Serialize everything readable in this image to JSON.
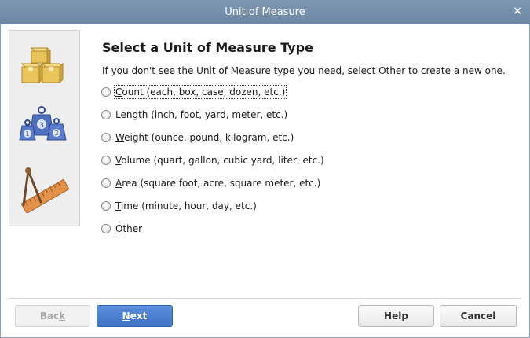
{
  "window": {
    "title": "Unit of Measure",
    "close_label": "×"
  },
  "main": {
    "heading": "Select a Unit of Measure Type",
    "instruction": "If you don't see the Unit of Measure type you need, select Other to create a new one.",
    "options": [
      {
        "accel": "C",
        "rest": "ount (each, box, case, dozen, etc.)",
        "selected": false
      },
      {
        "accel": "L",
        "rest": "ength (inch, foot, yard, meter, etc.)",
        "selected": false
      },
      {
        "accel": "W",
        "rest": "eight (ounce, pound, kilogram, etc.)",
        "selected": false
      },
      {
        "accel": "V",
        "rest": "olume (quart, gallon, cubic yard, liter, etc.)",
        "selected": false
      },
      {
        "accel": "A",
        "rest": "rea (square foot, acre, square meter, etc.)",
        "selected": false
      },
      {
        "accel": "T",
        "rest": "ime (minute, hour, day, etc.)",
        "selected": false
      },
      {
        "accel": "O",
        "rest": "ther",
        "selected": false
      }
    ]
  },
  "sidebar": {
    "icons": [
      "boxes-icon",
      "weights-icon",
      "ruler-compass-icon"
    ],
    "weight_numbers": [
      "1",
      "3",
      "2"
    ]
  },
  "footer": {
    "back": {
      "pre": "Bac",
      "accel": "k",
      "post": ""
    },
    "next": {
      "pre": "",
      "accel": "N",
      "post": "ext"
    },
    "help_label": "Help",
    "cancel_label": "Cancel"
  },
  "colors": {
    "titlebar": "#7290ae",
    "primary_button": "#4a7fd0",
    "box_gold": "#e8c45a",
    "weight_blue": "#4f6fbf",
    "ruler_orange": "#e3924a"
  }
}
